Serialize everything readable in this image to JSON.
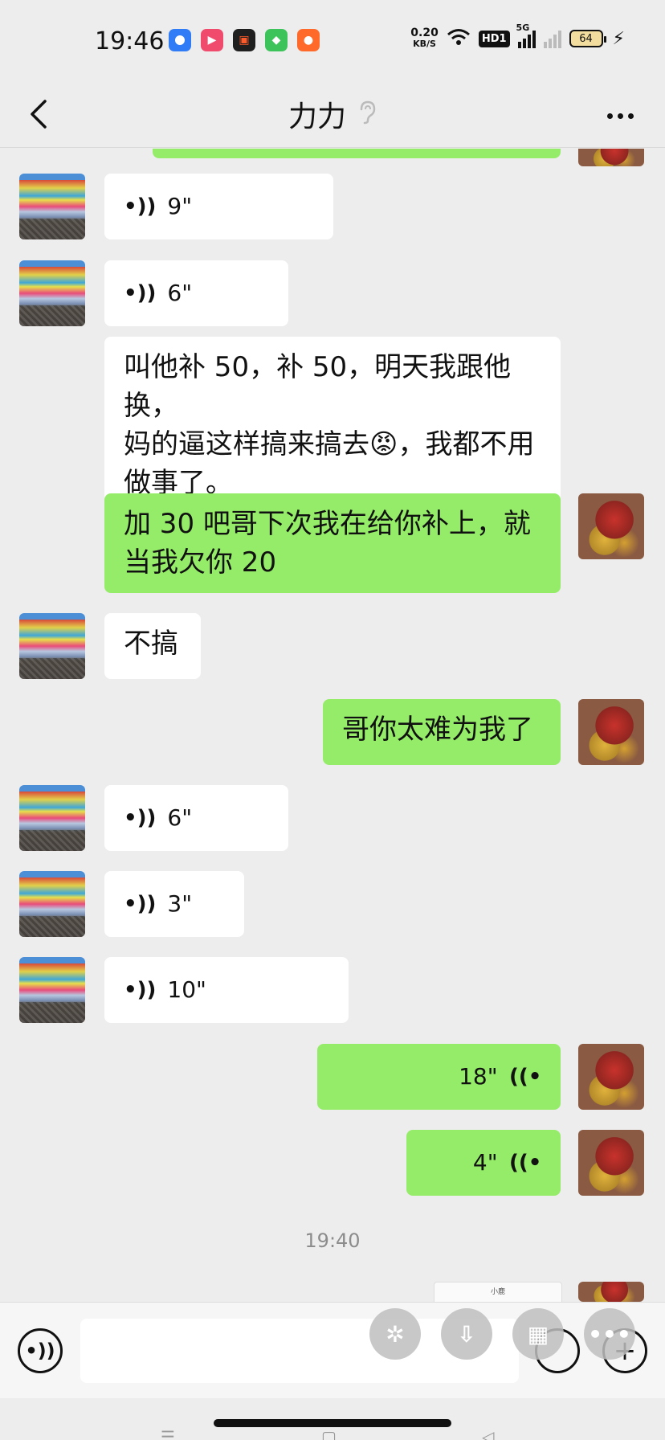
{
  "status_bar": {
    "time": "19:46",
    "net_speed_value": "0.20",
    "net_speed_unit": "KB/S",
    "hd_label": "HD1",
    "signal_label": "5G",
    "battery_level": "64",
    "app_icons": [
      {
        "name": "app-icon-blue",
        "color": "#2f7cf6"
      },
      {
        "name": "app-icon-video-red",
        "color": "#f04a6c"
      },
      {
        "name": "app-icon-record",
        "color": "#1f1f1f"
      },
      {
        "name": "app-icon-green",
        "color": "#3cc35a"
      },
      {
        "name": "app-icon-orange",
        "color": "#ff6a2b"
      }
    ]
  },
  "header": {
    "title": "力力",
    "back_icon": "chevron-left-icon",
    "ear_icon": "ear-icon",
    "more_icon": "more-dots-icon"
  },
  "messages": [
    {
      "side": "left",
      "type": "voice",
      "duration": "9\""
    },
    {
      "side": "left",
      "type": "voice",
      "duration": "6\""
    },
    {
      "side": "left",
      "type": "text",
      "lines": [
        "叫他补 50，补 50，明天我跟他换，",
        "妈的逼这样搞来搞去😡，我都不用",
        "做事了。"
      ]
    },
    {
      "side": "right",
      "type": "text",
      "lines": [
        "加 30 吧哥下次我在给你补上，就",
        "当我欠你 20"
      ]
    },
    {
      "side": "left",
      "type": "text",
      "lines": [
        "不搞"
      ]
    },
    {
      "side": "right",
      "type": "text",
      "lines": [
        "哥你太难为我了"
      ]
    },
    {
      "side": "left",
      "type": "voice",
      "duration": "6\""
    },
    {
      "side": "left",
      "type": "voice",
      "duration": "3\""
    },
    {
      "side": "left",
      "type": "voice",
      "duration": "10\""
    },
    {
      "side": "right",
      "type": "voice",
      "duration": "18\""
    },
    {
      "side": "right",
      "type": "voice",
      "duration": "4\""
    }
  ],
  "timestamp": "19:40",
  "thumbnail_caption": "小鹿",
  "colors": {
    "chat_bg": "#ededed",
    "bubble_left": "#ffffff",
    "bubble_right": "#95ec69"
  }
}
